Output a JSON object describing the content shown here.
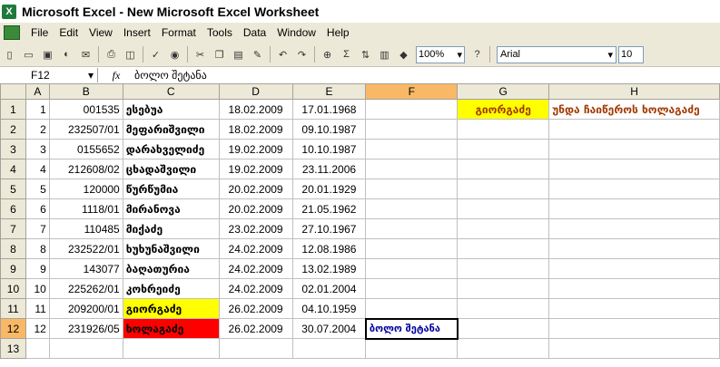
{
  "window": {
    "title": "Microsoft Excel - New Microsoft Excel Worksheet",
    "app_icon": "excel-icon"
  },
  "menu": [
    "File",
    "Edit",
    "View",
    "Insert",
    "Format",
    "Tools",
    "Data",
    "Window",
    "Help"
  ],
  "toolbar": {
    "zoom": "100%",
    "font": "Arial",
    "size": "10"
  },
  "formula_bar": {
    "name_box": "F12",
    "fx": "fx",
    "value": "ბოლო შეტანა"
  },
  "columns": [
    "A",
    "B",
    "C",
    "D",
    "E",
    "F",
    "G",
    "H"
  ],
  "rows": [
    {
      "n": "1",
      "a": "1",
      "b": "001535",
      "c": "ესებუა",
      "d": "18.02.2009",
      "e": "17.01.1968",
      "f": "",
      "g": "გიორგაძე",
      "h": "უნდა ჩაიწეროს ხოლაგაძე"
    },
    {
      "n": "2",
      "a": "2",
      "b": "232507/01",
      "c": "მეფარიშვილი",
      "d": "18.02.2009",
      "e": "09.10.1987",
      "f": "",
      "g": "",
      "h": ""
    },
    {
      "n": "3",
      "a": "3",
      "b": "0155652",
      "c": "დარახველიძე",
      "d": "19.02.2009",
      "e": "10.10.1987",
      "f": "",
      "g": "",
      "h": ""
    },
    {
      "n": "4",
      "a": "4",
      "b": "212608/02",
      "c": "ცხადაშვილი",
      "d": "19.02.2009",
      "e": "23.11.2006",
      "f": "",
      "g": "",
      "h": ""
    },
    {
      "n": "5",
      "a": "5",
      "b": "120000",
      "c": "წურწუმია",
      "d": "20.02.2009",
      "e": "20.01.1929",
      "f": "",
      "g": "",
      "h": ""
    },
    {
      "n": "6",
      "a": "6",
      "b": "1118/01",
      "c": "მირანოვა",
      "d": "20.02.2009",
      "e": "21.05.1962",
      "f": "",
      "g": "",
      "h": ""
    },
    {
      "n": "7",
      "a": "7",
      "b": "110485",
      "c": "მიქაძე",
      "d": "23.02.2009",
      "e": "27.10.1967",
      "f": "",
      "g": "",
      "h": ""
    },
    {
      "n": "8",
      "a": "8",
      "b": "232522/01",
      "c": "ხუხუნაშვილი",
      "d": "24.02.2009",
      "e": "12.08.1986",
      "f": "",
      "g": "",
      "h": ""
    },
    {
      "n": "9",
      "a": "9",
      "b": "143077",
      "c": "ბაღათურია",
      "d": "24.02.2009",
      "e": "13.02.1989",
      "f": "",
      "g": "",
      "h": ""
    },
    {
      "n": "10",
      "a": "10",
      "b": "225262/01",
      "c": "კოხრეიძე",
      "d": "24.02.2009",
      "e": "02.01.2004",
      "f": "",
      "g": "",
      "h": ""
    },
    {
      "n": "11",
      "a": "11",
      "b": "209200/01",
      "c": "გიორგაძე",
      "d": "26.02.2009",
      "e": "04.10.1959",
      "f": "",
      "g": "",
      "h": ""
    },
    {
      "n": "12",
      "a": "12",
      "b": "231926/05",
      "c": "ხოლაგაძე",
      "d": "26.02.2009",
      "e": "30.07.2004",
      "f": "ბოლო შეტანა",
      "g": "",
      "h": ""
    },
    {
      "n": "13",
      "a": "",
      "b": "",
      "c": "",
      "d": "",
      "e": "",
      "f": "",
      "g": "",
      "h": ""
    }
  ],
  "colors": {
    "yellow": "#ffff00",
    "red": "#ff0000",
    "selection": "#f9b865"
  }
}
